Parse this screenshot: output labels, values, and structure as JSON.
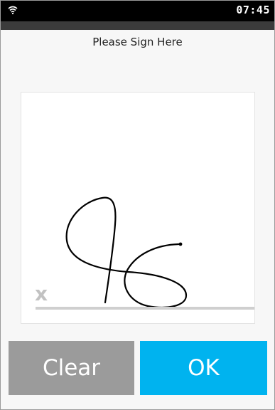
{
  "status_bar": {
    "time": "07:45",
    "wifi_icon": "wifi-icon"
  },
  "title": "Please Sign Here",
  "signature_pad": {
    "baseline_mark": "x"
  },
  "buttons": {
    "clear_label": "Clear",
    "ok_label": "OK"
  },
  "colors": {
    "status_bar": "#000000",
    "clear_button": "#9b9b9b",
    "ok_button": "#00b3ef",
    "ink": "#000000"
  }
}
